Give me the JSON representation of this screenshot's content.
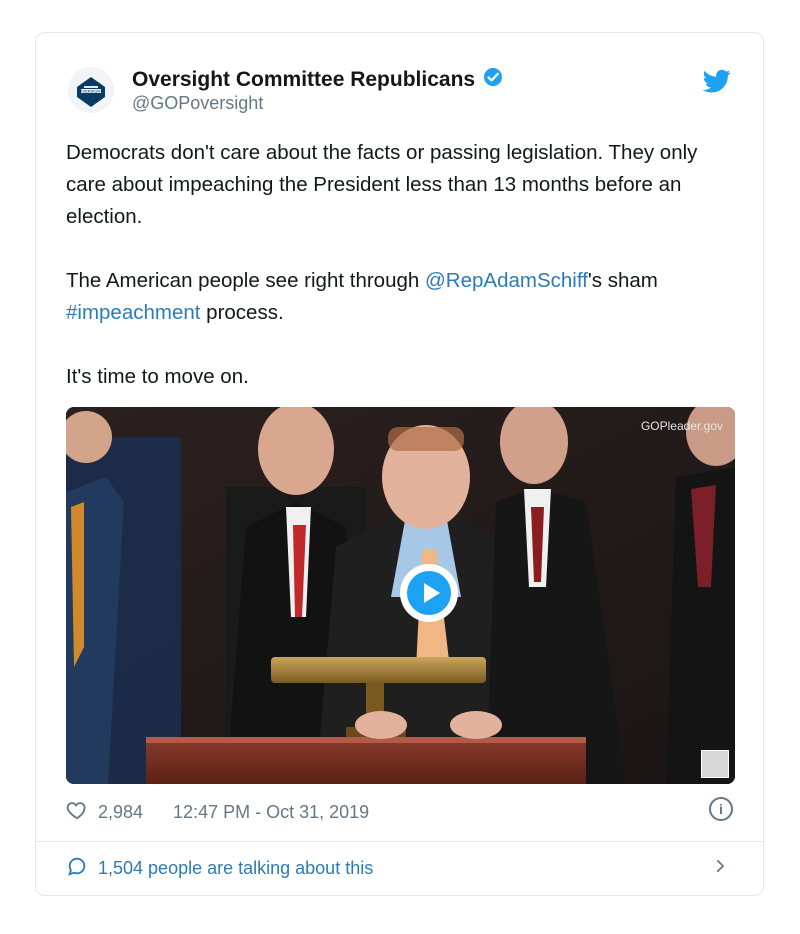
{
  "tweet": {
    "display_name": "Oversight Committee Republicans",
    "handle": "@GOPoversight",
    "avatar_text": "OVERSIGHT",
    "paragraphs": [
      {
        "text_1": "Democrats don't care about the facts or passing legislation. They only care about impeaching the President less than 13 months before an election."
      },
      {
        "text_before": "The American people see right through ",
        "mention": "@RepAdamSchiff",
        "text_mid": "'s sham ",
        "hashtag": "#impeachment",
        "text_after": " process."
      },
      {
        "text_3": "It's time to move on."
      }
    ],
    "media": {
      "watermark": "GOPleader.gov"
    },
    "meta": {
      "likes": "2,984",
      "timestamp": "12:47 PM - Oct 31, 2019"
    },
    "footer": {
      "talking": "1,504 people are talking about this"
    }
  },
  "colors": {
    "link": "#2b7bb9",
    "twitter_blue": "#1da1f2",
    "muted": "#657786",
    "border": "#e1e8ed"
  }
}
